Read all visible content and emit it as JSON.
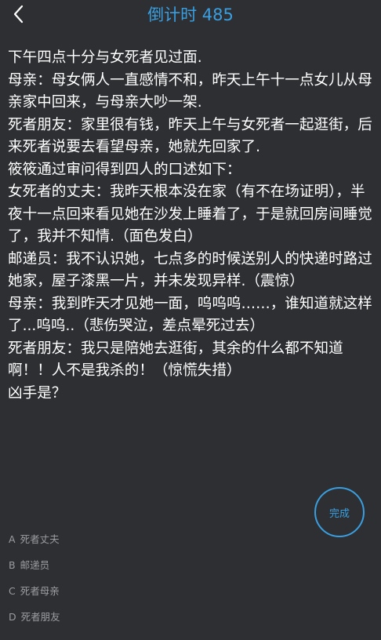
{
  "header": {
    "title": "倒计时 485"
  },
  "story": {
    "lines": [
      "下午四点十分与女死者见过面.",
      "母亲：母女俩人一直感情不和，昨天上午十一点女儿从母亲家中回来，与母亲大吵一架.",
      "死者朋友：家里很有钱，昨天上午与女死者一起逛街，后来死者说要去看望母亲，她就先回家了.",
      "筱筱通过审问得到四人的口述如下：",
      "女死者的丈夫：我昨天根本没在家（有不在场证明），半夜十一点回来看见她在沙发上睡着了，于是就回房间睡觉了，我并不知情.（面色发白）",
      "邮递员：我不认识她，七点多的时候送别人的快递时路过她家，屋子漆黑一片，并未发现异样.（震惊）",
      "母亲：我到昨天才见她一面，呜呜呜……，谁知道就这样了...呜呜..（悲伤哭泣，差点晕死过去）",
      "死者朋友：我只是陪她去逛街，其余的什么都不知道啊！！人不是我杀的！（惊慌失措）",
      "凶手是？"
    ]
  },
  "done_button": {
    "label": "完成"
  },
  "options": [
    {
      "letter": "A",
      "text": "死者丈夫"
    },
    {
      "letter": "B",
      "text": "邮递员"
    },
    {
      "letter": "C",
      "text": "死者母亲"
    },
    {
      "letter": "D",
      "text": "死者朋友"
    }
  ],
  "colors": {
    "background": "#2d2f33",
    "accent": "#3a9fe0",
    "text": "#ffffff",
    "muted": "#9a9ca0"
  },
  "icons": {
    "back": "chevron-left-icon"
  }
}
